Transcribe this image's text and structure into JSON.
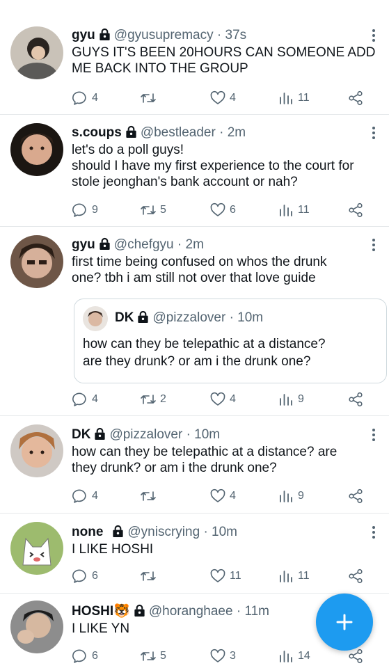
{
  "tweets": [
    {
      "name": "gyu",
      "handle": "@gyusupremacy",
      "time": "· 37s",
      "text": "GUYS IT'S BEEN 20HOURS CAN SOMEONE ADD\nME BACK INTO THE GROUP",
      "replies": "4",
      "retweets": "",
      "likes": "4",
      "views": "11"
    },
    {
      "name": "s.coups",
      "handle": "@bestleader",
      "time": "· 2m",
      "text": "let's do a poll guys!\nshould I have my first experience to the court for\nstole jeonghan's bank account or nah?",
      "replies": "9",
      "retweets": "5",
      "likes": "6",
      "views": "11"
    },
    {
      "name": "gyu",
      "handle": "@chefgyu",
      "time": "· 2m",
      "text": "first time being confused on whos the drunk\none? tbh i am still not over that love guide",
      "quote": {
        "name": "DK",
        "handle": "@pizzalover",
        "time": "· 10m",
        "text": "how can they be telepathic at a distance?\nare they drunk? or am i the drunk one?"
      },
      "replies": "4",
      "retweets": "2",
      "likes": "4",
      "views": "9"
    },
    {
      "name": "DK",
      "handle": "@pizzalover",
      "time": "· 10m",
      "text": "how can they be telepathic at a distance? are\nthey drunk? or am i the drunk one?",
      "replies": "4",
      "retweets": "",
      "likes": "4",
      "views": "9"
    },
    {
      "name": "none",
      "handle": "@yniscrying",
      "time": "· 10m",
      "text": "I LIKE HOSHI",
      "replies": "6",
      "retweets": "",
      "likes": "11",
      "views": "11"
    },
    {
      "name": "HOSHI🐯",
      "handle": "@horanghaee",
      "time": "· 11m",
      "text": "I LIKE YN",
      "replies": "6",
      "retweets": "5",
      "likes": "3",
      "views": "14"
    }
  ],
  "icons": {
    "lock": "lock-icon",
    "more": "more-vertical-icon",
    "reply": "reply-icon",
    "retweet": "retweet-icon",
    "like": "heart-icon",
    "views": "views-icon",
    "share": "share-icon",
    "compose": "plus-icon"
  },
  "colors": {
    "accent": "#1d9bf0",
    "muted": "#536471",
    "text": "#0f1419",
    "divider": "#e6e9eb"
  }
}
